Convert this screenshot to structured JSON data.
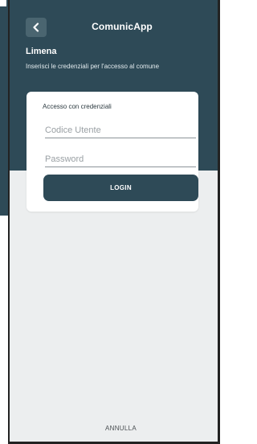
{
  "header": {
    "title": "ComunicApp",
    "back_icon": "chevron-left-icon",
    "municipality": "Limena",
    "instructions": "Inserisci le credenziali per l'accesso al comune"
  },
  "login_card": {
    "title": "Accesso con credenziali",
    "user_code": {
      "placeholder": "Codice Utente",
      "value": ""
    },
    "password": {
      "placeholder": "Password",
      "value": ""
    },
    "login_label": "LOGIN"
  },
  "footer": {
    "cancel_label": "ANNULLA"
  },
  "colors": {
    "primary": "#2e4a57",
    "background": "#eceeef",
    "card": "#ffffff"
  }
}
